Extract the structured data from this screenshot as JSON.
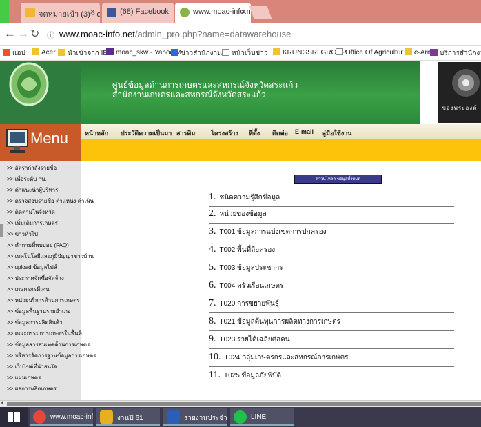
{
  "browser": {
    "tabs": [
      {
        "label": "จดหมายเข้า (3) - opsmoac",
        "icon_color": "#f1b731",
        "icon": "mail-icon"
      },
      {
        "label": "(68) Facebook",
        "icon_color": "#3b5998",
        "icon": "facebook-icon"
      },
      {
        "label": "www.moac-info.net/adm",
        "icon_color": "#8ab34a",
        "icon": "site-icon"
      }
    ],
    "address": {
      "host": "www.moac-info.net",
      "path": "/admin_pro.php?name=datawarehouse"
    },
    "bookmarks": [
      {
        "label": "แอป",
        "color": "#e05a2a"
      },
      {
        "label": "Acer",
        "color": "#f1c232"
      },
      {
        "label": "นำเข้าจาก IE",
        "color": "#f1c232"
      },
      {
        "label": "moac_skw - Yahoo M",
        "color": "#5b2d8e"
      },
      {
        "label": "ข่าวสำนักงานฯ",
        "color": "#2a6bd1"
      },
      {
        "label": "หน้าเว็บข่าว",
        "color": "#888888"
      },
      {
        "label": "KRUNGSRI GROUP",
        "color": "#f1c232"
      },
      {
        "label": "Office Of Agricultur",
        "color": "#888888"
      },
      {
        "label": "e-Army",
        "color": "#f1c232"
      },
      {
        "label": "บริการสำนักงาน",
        "color": "#7a3a9a"
      }
    ]
  },
  "banner": {
    "title_line1": "ศูนย์ข้อมูลด้านการเกษตรและสหกรณ์จังหวัดสระแก้ว",
    "title_line2": "สำนักงานเกษตรและสหกรณ์จังหวัดสระแก้ว",
    "emblem_text": "ของพระองค์"
  },
  "menu_title": "Menu",
  "nav_links": [
    "หน้าหลัก",
    "ประวัติความเป็นมา",
    "สารคิม",
    "โครงสร้าง",
    "ที่ตั้ง",
    "ติดต่อ",
    "E-mail",
    "คู่มือใช้งาน"
  ],
  "sidebar": [
    "อัตรากำลังรายชื่อ",
    "เพื่อระดับ กษ.",
    "คำแนะนำผู้บริหาร",
    "ตรวจสอบรายชื่อ ตำแหน่ง ดำเนิน",
    "ติดตามในจังหวัด",
    "เพิ่มเติมการเกษตร",
    "ข่าวทั่วไป",
    "คำถามที่พบบ่อย (FAQ)",
    "เทคโนโลยีและภูมิปัญญาชาวบ้าน",
    "upload ข้อมูลไฟล์",
    "ประกาศจัดซื้อจัดจ้าง",
    "เกษตรกรดีเด่น",
    "หน่วยบริการด้านการเกษตร",
    "ข้อมูลพื้นฐานรายอำเภอ",
    "ข้อมูลการผลิตสินค้า",
    "คณะกรรมการเกษตรในพื้นที่",
    "ข้อมูลสารสนเทศด้านการเกษตร",
    "บริหารจัดการฐานข้อมูลการเกษตร",
    "เว็บไซต์ที่น่าสนใจ",
    "แผนเกษตร",
    "ผลการผลิตเกษตร"
  ],
  "download_button": "ดาวน์โหลด ข้อมูลทั้งหมด",
  "data_rows": [
    {
      "num": "1.",
      "label": "ชนิดความรู้สึกข้อมูล"
    },
    {
      "num": "2.",
      "label": "หน่วยของข้อมูล"
    },
    {
      "num": "3.",
      "label": "T001 ข้อมูลการแบ่งเขตการปกครอง"
    },
    {
      "num": "4.",
      "label": "T002 พื้นที่ถือครอง"
    },
    {
      "num": "5.",
      "label": "T003 ข้อมูลประชากร"
    },
    {
      "num": "6.",
      "label": "T004 ครัวเรือนเกษตร"
    },
    {
      "num": "7.",
      "label": "T020 การขยายพันธุ์"
    },
    {
      "num": "8.",
      "label": "T021 ข้อมูลต้นทุนการผลิตทางการเกษตร"
    },
    {
      "num": "9.",
      "label": "T023 รายได้เฉลี่ยต่อคน"
    },
    {
      "num": "10.",
      "label": "T024 กลุ่มเกษตรกรและสหกรณ์การเกษตร"
    },
    {
      "num": "11.",
      "label": "T025 ข้อมูลภัยพิบัติ"
    }
  ],
  "taskbar": [
    {
      "label": "www.moac-info...",
      "color": "#e8453c"
    },
    {
      "label": "งานปี 61",
      "color": "#e8b020"
    },
    {
      "label": "รายงานประจำปี 60 ก...",
      "color": "#2b5fb5"
    },
    {
      "label": "LINE",
      "color": "#21c04a"
    }
  ]
}
